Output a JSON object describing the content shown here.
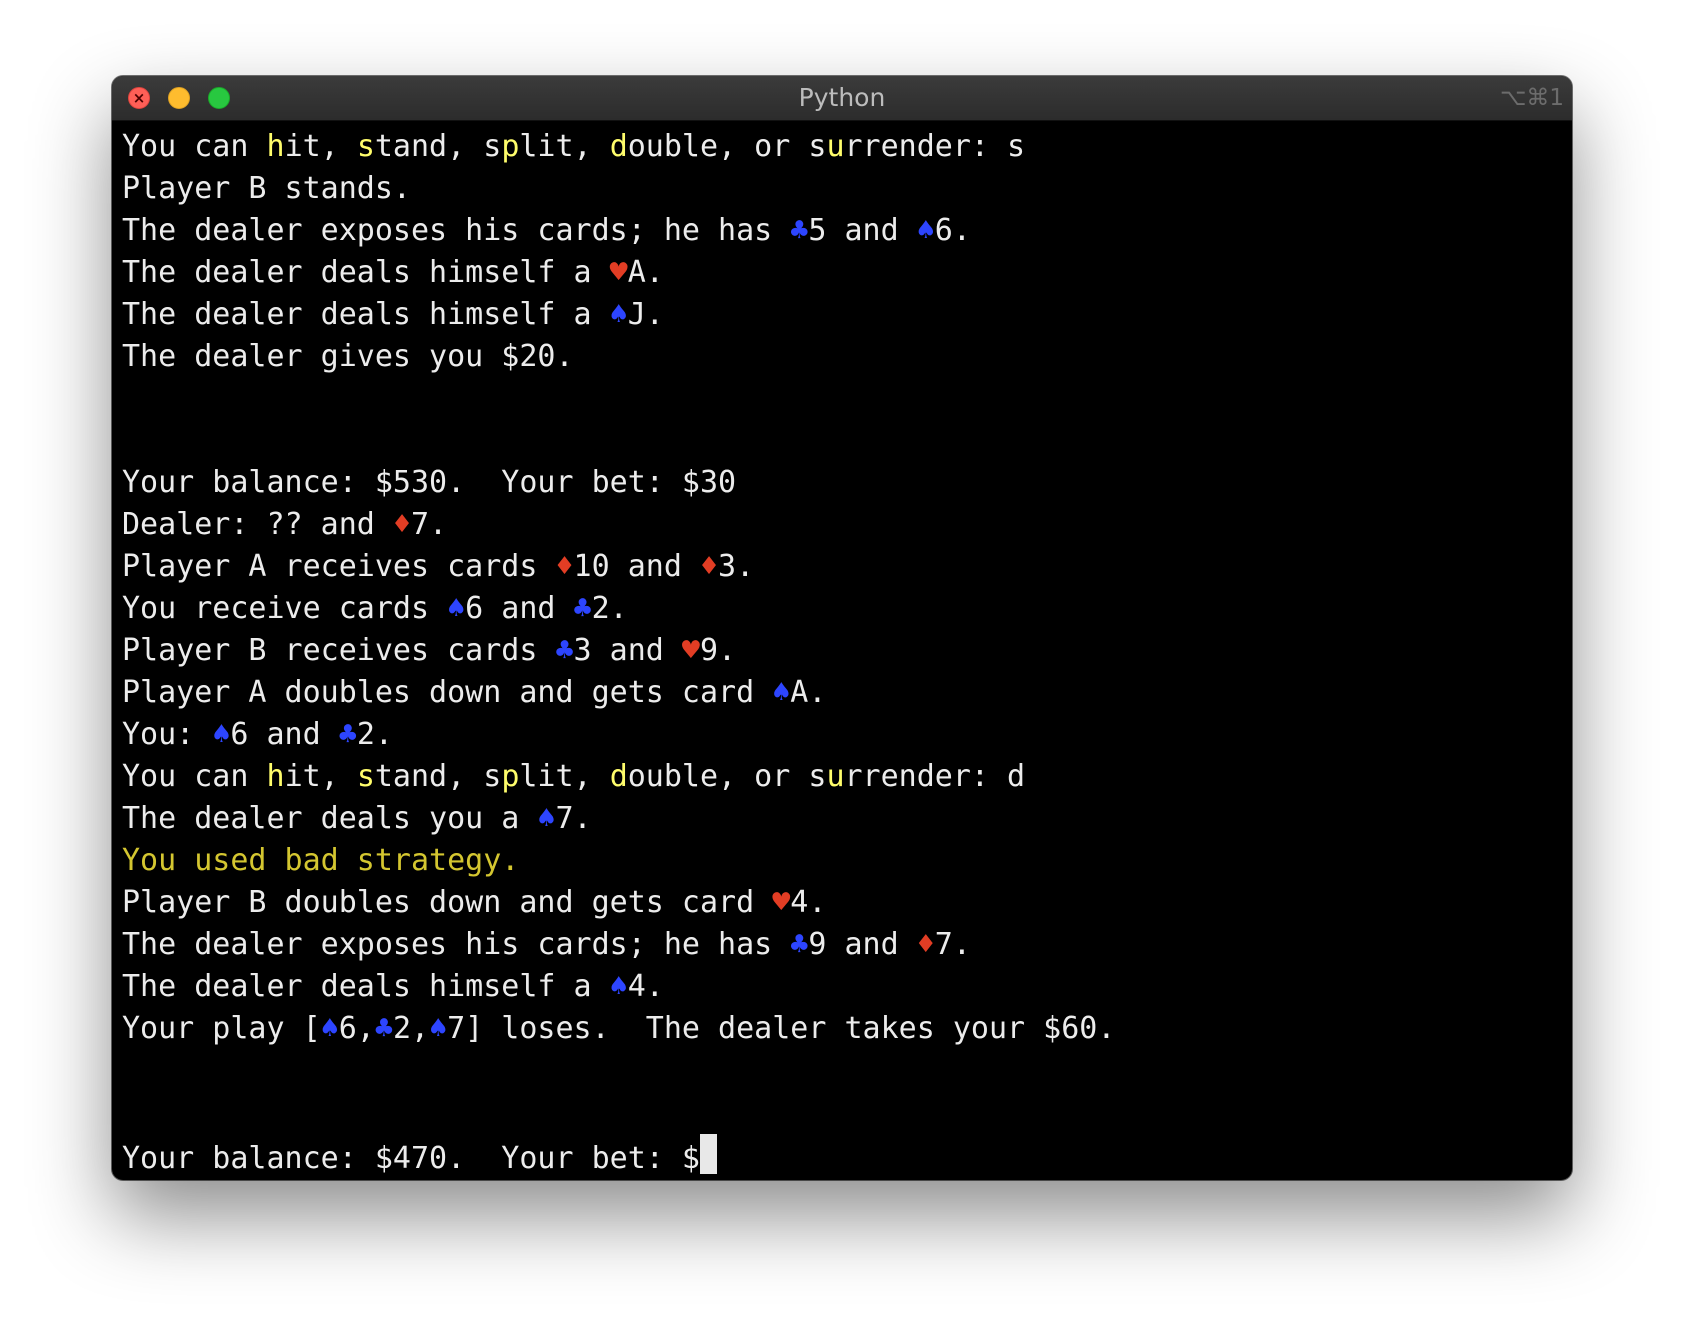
{
  "window": {
    "title": "Python",
    "shortcut": "⌥⌘1",
    "close_glyph": "×"
  },
  "colors": {
    "background": "#000000",
    "text": "#ececec",
    "highlight_letter": "#fffd6b",
    "warning": "#d4c630",
    "black_suit": "#2d45ff",
    "red_suit": "#e23d24"
  },
  "icons": {
    "club": "♣",
    "spade": "♠",
    "heart": "♥",
    "diamond": "♦"
  },
  "terminal": {
    "lines": [
      [
        "You can ",
        {
          "t": "h",
          "c": "hl"
        },
        "it, ",
        {
          "t": "s",
          "c": "hl"
        },
        "tand, s",
        {
          "t": "p",
          "c": "hl"
        },
        "lit, ",
        {
          "t": "d",
          "c": "hl"
        },
        "ouble, or s",
        {
          "t": "u",
          "c": "hl"
        },
        "rrender: s"
      ],
      [
        "Player B stands."
      ],
      [
        "The dealer exposes his cards; he has ",
        {
          "t": "♣",
          "c": "suit-black"
        },
        "5 and ",
        {
          "t": "♠",
          "c": "suit-black"
        },
        "6."
      ],
      [
        "The dealer deals himself a ",
        {
          "t": "♥",
          "c": "suit-red"
        },
        "A."
      ],
      [
        "The dealer deals himself a ",
        {
          "t": "♠",
          "c": "suit-black"
        },
        "J."
      ],
      [
        "The dealer gives you $20."
      ],
      [
        ""
      ],
      [
        ""
      ],
      [
        "Your balance: $530.  Your bet: $30"
      ],
      [
        "Dealer: ?? and ",
        {
          "t": "♦",
          "c": "suit-red"
        },
        "7."
      ],
      [
        "Player A receives cards ",
        {
          "t": "♦",
          "c": "suit-red"
        },
        "10 and ",
        {
          "t": "♦",
          "c": "suit-red"
        },
        "3."
      ],
      [
        "You receive cards ",
        {
          "t": "♠",
          "c": "suit-black"
        },
        "6 and ",
        {
          "t": "♣",
          "c": "suit-black"
        },
        "2."
      ],
      [
        "Player B receives cards ",
        {
          "t": "♣",
          "c": "suit-black"
        },
        "3 and ",
        {
          "t": "♥",
          "c": "suit-red"
        },
        "9."
      ],
      [
        "Player A doubles down and gets card ",
        {
          "t": "♠",
          "c": "suit-black"
        },
        "A."
      ],
      [
        "You: ",
        {
          "t": "♠",
          "c": "suit-black"
        },
        "6 and ",
        {
          "t": "♣",
          "c": "suit-black"
        },
        "2."
      ],
      [
        "You can ",
        {
          "t": "h",
          "c": "hl"
        },
        "it, ",
        {
          "t": "s",
          "c": "hl"
        },
        "tand, s",
        {
          "t": "p",
          "c": "hl"
        },
        "lit, ",
        {
          "t": "d",
          "c": "hl"
        },
        "ouble, or s",
        {
          "t": "u",
          "c": "hl"
        },
        "rrender: d"
      ],
      [
        "The dealer deals you a ",
        {
          "t": "♠",
          "c": "suit-black"
        },
        "7."
      ],
      [
        {
          "t": "You used bad strategy.",
          "c": "warn"
        }
      ],
      [
        "Player B doubles down and gets card ",
        {
          "t": "♥",
          "c": "suit-red"
        },
        "4."
      ],
      [
        "The dealer exposes his cards; he has ",
        {
          "t": "♣",
          "c": "suit-black"
        },
        "9 and ",
        {
          "t": "♦",
          "c": "suit-red"
        },
        "7."
      ],
      [
        "The dealer deals himself a ",
        {
          "t": "♠",
          "c": "suit-black"
        },
        "4."
      ],
      [
        "Your play [",
        {
          "t": "♠",
          "c": "suit-black"
        },
        "6,",
        {
          "t": "♣",
          "c": "suit-black"
        },
        "2,",
        {
          "t": "♠",
          "c": "suit-black"
        },
        "7] loses.  The dealer takes your $60."
      ],
      [
        ""
      ],
      [
        ""
      ]
    ],
    "prompt": "Your balance: $470.  Your bet: $"
  }
}
